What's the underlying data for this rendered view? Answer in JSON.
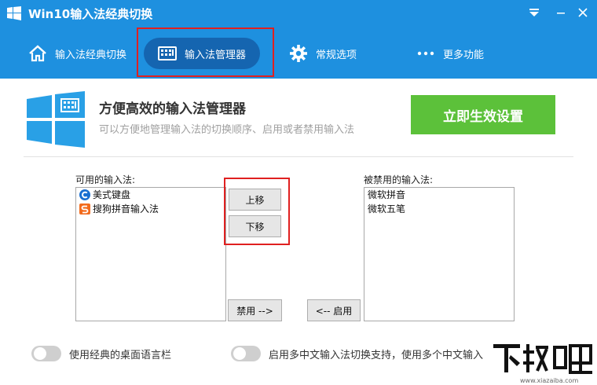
{
  "window": {
    "title": "Win10输入法经典切换"
  },
  "tabs": [
    {
      "label": "输入法经典切换",
      "icon": "home-icon"
    },
    {
      "label": "输入法管理器",
      "icon": "keyboard-icon"
    },
    {
      "label": "常规选项",
      "icon": "gear-icon"
    },
    {
      "label": "更多功能",
      "icon": "more-icon"
    }
  ],
  "hero": {
    "title": "方便高效的输入法管理器",
    "subtitle": "可以方便地管理输入法的切换顺序、启用或者禁用输入法",
    "apply_label": "立即生效设置"
  },
  "available": {
    "label": "可用的输入法:",
    "items": [
      {
        "label": "美式键盘",
        "icon": "us-keyboard-icon"
      },
      {
        "label": "搜狗拼音输入法",
        "icon": "sogou-icon"
      }
    ]
  },
  "disabled": {
    "label": "被禁用的输入法:",
    "items": [
      {
        "label": "微软拼音"
      },
      {
        "label": "微软五笔"
      }
    ]
  },
  "buttons": {
    "move_up": "上移",
    "move_down": "下移",
    "disable": "禁用 -->",
    "enable": "<-- 启用"
  },
  "options": {
    "classic_langbar": "使用经典的桌面语言栏",
    "multi_chinese": "启用多中文输入法切换支持，使用多个中文输入"
  },
  "colors": {
    "header": "#1e90df",
    "apply": "#5cc13a",
    "highlight": "#e02020"
  }
}
